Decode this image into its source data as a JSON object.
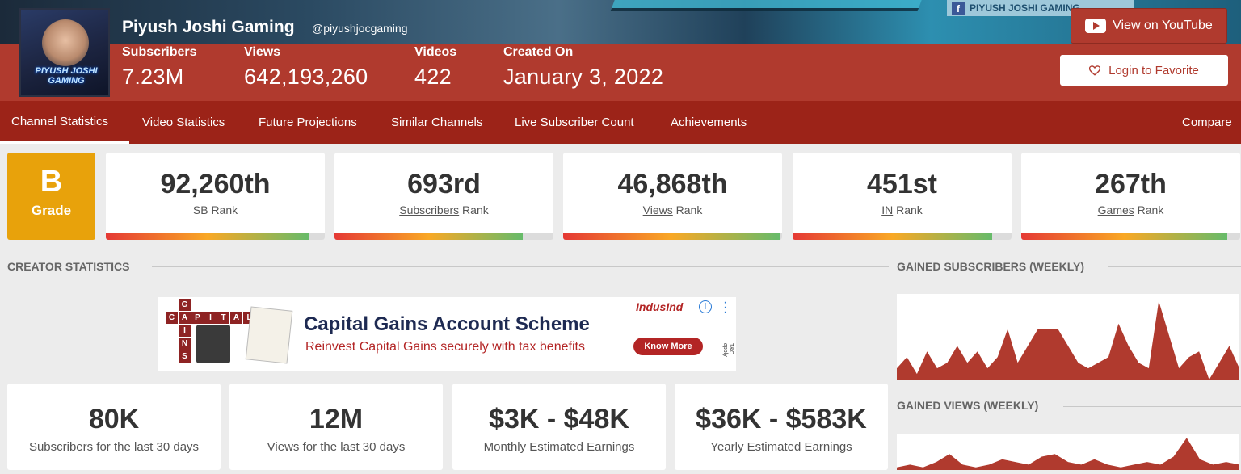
{
  "channel": {
    "name": "Piyush Joshi Gaming",
    "handle": "@piyushjocgaming",
    "avatar_text": "PIYUSH JOSHI GAMING",
    "banner_text": "PIYUSH JOSHI GAMING",
    "stats": [
      {
        "label": "Subscribers",
        "value": "7.23M"
      },
      {
        "label": "Views",
        "value": "642,193,260"
      },
      {
        "label": "Videos",
        "value": "422"
      },
      {
        "label": "Created On",
        "value": "January 3, 2022"
      }
    ]
  },
  "buttons": {
    "youtube": "View on YouTube",
    "favorite": "Login to Favorite"
  },
  "nav": {
    "tabs": [
      {
        "label": "Channel Statistics",
        "active": true
      },
      {
        "label": "Video Statistics"
      },
      {
        "label": "Future Projections"
      },
      {
        "label": "Similar Channels"
      },
      {
        "label": "Live Subscriber Count"
      },
      {
        "label": "Achievements"
      }
    ],
    "compare": "Compare"
  },
  "grade": {
    "letter": "B",
    "label": "Grade"
  },
  "ranks": [
    {
      "value": "92,260th",
      "label_link": "",
      "label_rest": "SB Rank",
      "fill": 0.93
    },
    {
      "value": "693rd",
      "label_link": "Subscribers",
      "label_rest": " Rank",
      "fill": 0.86
    },
    {
      "value": "46,868th",
      "label_link": "Views",
      "label_rest": " Rank",
      "fill": 0.99
    },
    {
      "value": "451st",
      "label_link": "IN",
      "label_rest": " Rank",
      "fill": 0.91
    },
    {
      "value": "267th",
      "label_link": "Games",
      "label_rest": " Rank",
      "fill": 0.94
    }
  ],
  "sections": {
    "creator_statistics": "CREATOR STATISTICS",
    "gained_subscribers": "GAINED SUBSCRIBERS (WEEKLY)",
    "gained_views": "GAINED VIEWS (WEEKLY)"
  },
  "ad": {
    "title": "Capital Gains Account Scheme",
    "subtitle": "Reinvest Capital Gains securely with tax benefits",
    "brand": "IndusInd",
    "cta": "Know More",
    "tiles_row": [
      "C",
      "A",
      "P",
      "I",
      "T",
      "A",
      "L"
    ],
    "tiles_col": [
      "G",
      "A",
      "I",
      "N",
      "S"
    ],
    "tc": "T&C apply"
  },
  "creator_stats": [
    {
      "value": "80K",
      "label": "Subscribers for the last 30 days"
    },
    {
      "value": "12M",
      "label": "Views for the last 30 days"
    },
    {
      "value": "$3K - $48K",
      "label": "Monthly Estimated Earnings"
    },
    {
      "value": "$36K - $583K",
      "label": "Yearly Estimated Earnings"
    }
  ],
  "colors": {
    "brand_red": "#b03a2e",
    "nav_red": "#9c2318",
    "grade_orange": "#e8a20b",
    "chart_red": "#b03a2e"
  },
  "chart_data": [
    {
      "type": "area",
      "values": [
        2,
        4,
        1,
        5,
        2,
        3,
        6,
        3,
        5,
        2,
        4,
        9,
        3,
        6,
        9,
        9,
        9,
        6,
        3,
        2,
        3,
        4,
        10,
        6,
        3,
        2,
        14,
        8,
        2,
        4,
        5,
        0,
        3,
        6,
        2
      ],
      "ylim": [
        0,
        15
      ]
    },
    {
      "type": "area",
      "values": [
        1,
        2,
        1,
        3,
        6,
        2,
        1,
        2,
        4,
        3,
        2,
        5,
        6,
        3,
        2,
        4,
        2,
        1,
        2,
        3,
        2,
        5,
        12,
        4,
        2,
        3,
        2
      ],
      "ylim": [
        0,
        13
      ]
    }
  ]
}
